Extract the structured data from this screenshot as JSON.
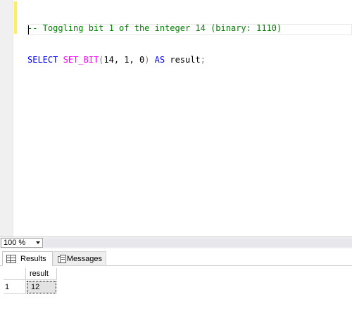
{
  "editor": {
    "lines": [
      {
        "comment": "-- Toggling bit 1 of the integer 14 (binary: 1110)"
      },
      {
        "select_kw": "SELECT",
        "fn_name": "SET_BIT",
        "open_paren": "(",
        "args": "14, 1, 0",
        "close_paren": ")",
        "as_kw": "AS",
        "alias": "result",
        "terminator": ";"
      }
    ]
  },
  "status": {
    "zoom": "100 %"
  },
  "results_tabs": {
    "results_label": "Results",
    "messages_label": "Messages"
  },
  "results_grid": {
    "columns": [
      "result"
    ],
    "rows": [
      {
        "row_number": "1",
        "values": [
          "12"
        ]
      }
    ]
  },
  "colors": {
    "keyword": "#0000ff",
    "function": "#ff00ff",
    "comment": "#008000",
    "change_marker": "#ffee62"
  }
}
